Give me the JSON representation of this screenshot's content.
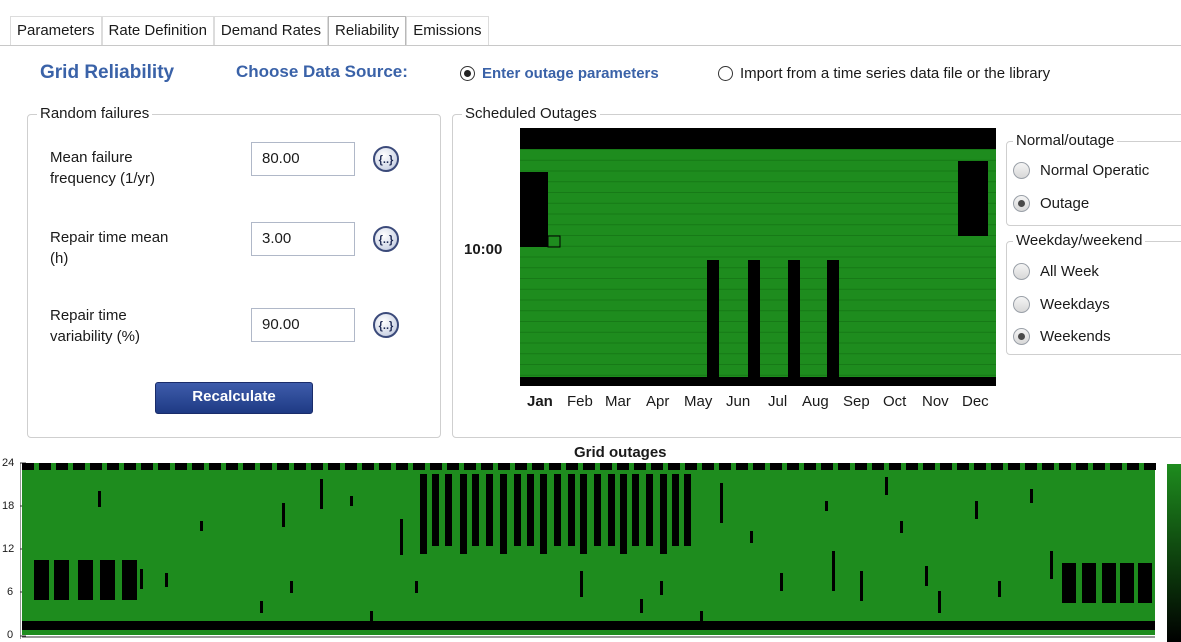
{
  "tabs": [
    "Parameters",
    "Rate Definition",
    "Demand Rates",
    "Reliability",
    "Emissions"
  ],
  "active_tab": "Reliability",
  "header": {
    "title": "Grid Reliability",
    "choose_source_label": "Choose Data Source:",
    "source_option_1": "Enter outage parameters",
    "source_option_2": "Import from a time series data file or the library",
    "selected_source": "Enter outage parameters"
  },
  "random_failures": {
    "group_label": "Random failures",
    "fields": [
      {
        "label_line1": "Mean failure",
        "label_line2": "frequency (1/yr)",
        "value": "80.00",
        "button_icon": "{..}"
      },
      {
        "label_line1": "Repair time mean",
        "label_line2": "(h)",
        "value": "3.00",
        "button_icon": "{..}"
      },
      {
        "label_line1": "Repair time",
        "label_line2": "variability (%)",
        "value": "90.00",
        "button_icon": "{..}"
      }
    ],
    "recalculate_label": "Recalculate"
  },
  "scheduled_outages": {
    "group_label": "Scheduled Outages",
    "hour_label": "10:00",
    "months": [
      "Jan",
      "Feb",
      "Mar",
      "Apr",
      "May",
      "Jun",
      "Jul",
      "Aug",
      "Sep",
      "Oct",
      "Nov",
      "Dec"
    ],
    "selected_month": "Jan",
    "normal_outage": {
      "group_label": "Normal/outage",
      "options": [
        "Normal Operatic",
        "Outage"
      ],
      "selected": "Outage"
    },
    "weekday_weekend": {
      "group_label": "Weekday/weekend",
      "options": [
        "All Week",
        "Weekdays",
        "Weekends"
      ],
      "selected": "Weekends"
    }
  },
  "grid_outages_chart": {
    "title": "Grid outages",
    "y_ticks": [
      "24",
      "18",
      "12",
      "6",
      "0"
    ]
  },
  "colors": {
    "accent": "#3a62a8",
    "grid_green": "#1e8c1e",
    "outage_black": "#000000"
  }
}
